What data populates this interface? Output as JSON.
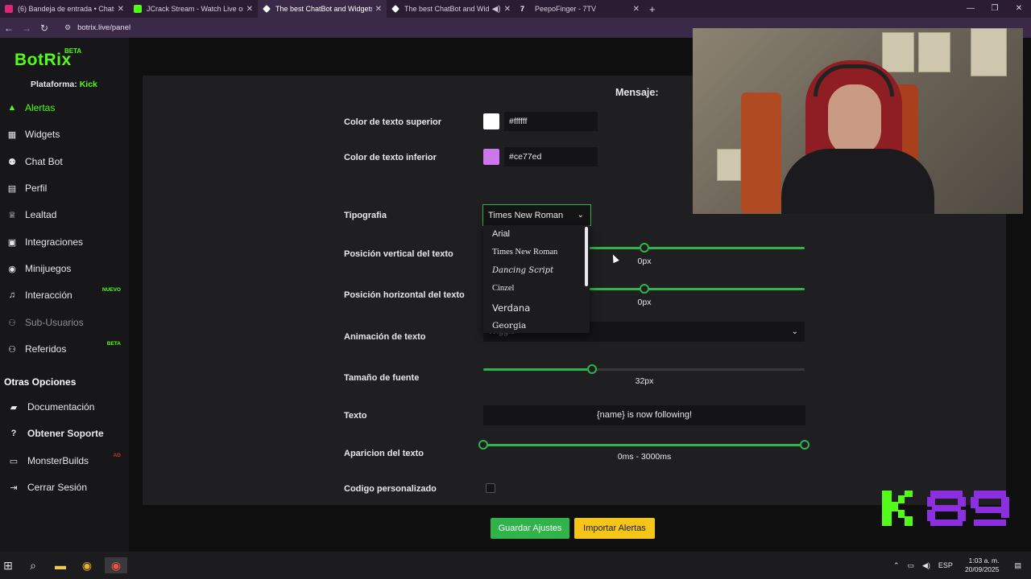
{
  "browser": {
    "tabs": [
      {
        "title": "(6) Bandeja de entrada • Chats",
        "icon": "instagram-icon",
        "color": "#d62976",
        "active": false
      },
      {
        "title": "JCrack Stream - Watch Live on K",
        "icon": "kick-icon",
        "color": "#53fc18",
        "active": false
      },
      {
        "title": "The best ChatBot and Widgets",
        "icon": "botrix-icon",
        "color": "#ffffff",
        "active": true
      },
      {
        "title": "The best ChatBot and Widg",
        "icon": "botrix-icon",
        "color": "#ffffff",
        "active": false,
        "audio": true
      },
      {
        "title": "PeepoFinger - 7TV",
        "icon": "7tv-icon",
        "color": "#ffffff",
        "active": false
      }
    ],
    "url": "botrix.live/panel"
  },
  "sidebar": {
    "brand": "BotRix",
    "brand_badge": "BETA",
    "platform_label": "Plataforma:",
    "platform_value": "Kick",
    "items": [
      {
        "label": "Alertas",
        "icon": "warning-icon",
        "active": true
      },
      {
        "label": "Widgets",
        "icon": "grid-icon"
      },
      {
        "label": "Chat Bot",
        "icon": "robot-icon"
      },
      {
        "label": "Perfil",
        "icon": "id-card-icon"
      },
      {
        "label": "Lealtad",
        "icon": "trophy-icon"
      },
      {
        "label": "Integraciones",
        "icon": "server-icon"
      },
      {
        "label": "Minijuegos",
        "icon": "gamepad-icon"
      },
      {
        "label": "Interacción",
        "icon": "music-icon",
        "badge": "NUEVO"
      },
      {
        "label": "Sub-Usuarios",
        "icon": "users-icon",
        "dim": true
      },
      {
        "label": "Referidos",
        "icon": "users-icon",
        "badge": "BETA"
      }
    ],
    "section_title": "Otras Opciones",
    "other_items": [
      {
        "label": "Documentación",
        "icon": "book-icon"
      },
      {
        "label": "Obtener Soporte",
        "icon": "question-icon",
        "bold": true
      },
      {
        "label": "MonsterBuilds",
        "icon": "monitor-icon",
        "badge": "AD"
      },
      {
        "label": "Cerrar Sesión",
        "icon": "logout-icon"
      }
    ]
  },
  "form": {
    "message_heading": "Mensaje:",
    "top_color": {
      "label": "Color de texto superior",
      "value": "#ffffff"
    },
    "bottom_color": {
      "label": "Color de texto inferior",
      "value": "#ce77ed"
    },
    "typography": {
      "label": "Tipografia",
      "value": "Times New Roman",
      "options": [
        "Arial",
        "Times New Roman",
        "Dancing Script",
        "Cinzel",
        "Verdana",
        "Georgia"
      ]
    },
    "vertical_position": {
      "label": "Posición vertical del texto",
      "value": "0px"
    },
    "horizontal_position": {
      "label": "Posición horizontal del texto",
      "value": "0px"
    },
    "animation": {
      "label": "Animación de texto",
      "value": "Wiggle"
    },
    "font_size": {
      "label": "Tamaño de fuente",
      "value": "32px"
    },
    "text": {
      "label": "Texto",
      "value": "{name} is now following!"
    },
    "appearance": {
      "label": "Aparicion del texto",
      "value": "0ms - 3000ms"
    },
    "custom_code": {
      "label": "Codigo personalizado",
      "checked": false
    },
    "save_button": "Guardar Ajustes",
    "import_button": "Importar Alertas"
  },
  "overlay": {
    "logo_text": "K 89"
  },
  "taskbar": {
    "lang": "ESP",
    "time": "1:03 a. m.",
    "date": "20/09/2025"
  }
}
